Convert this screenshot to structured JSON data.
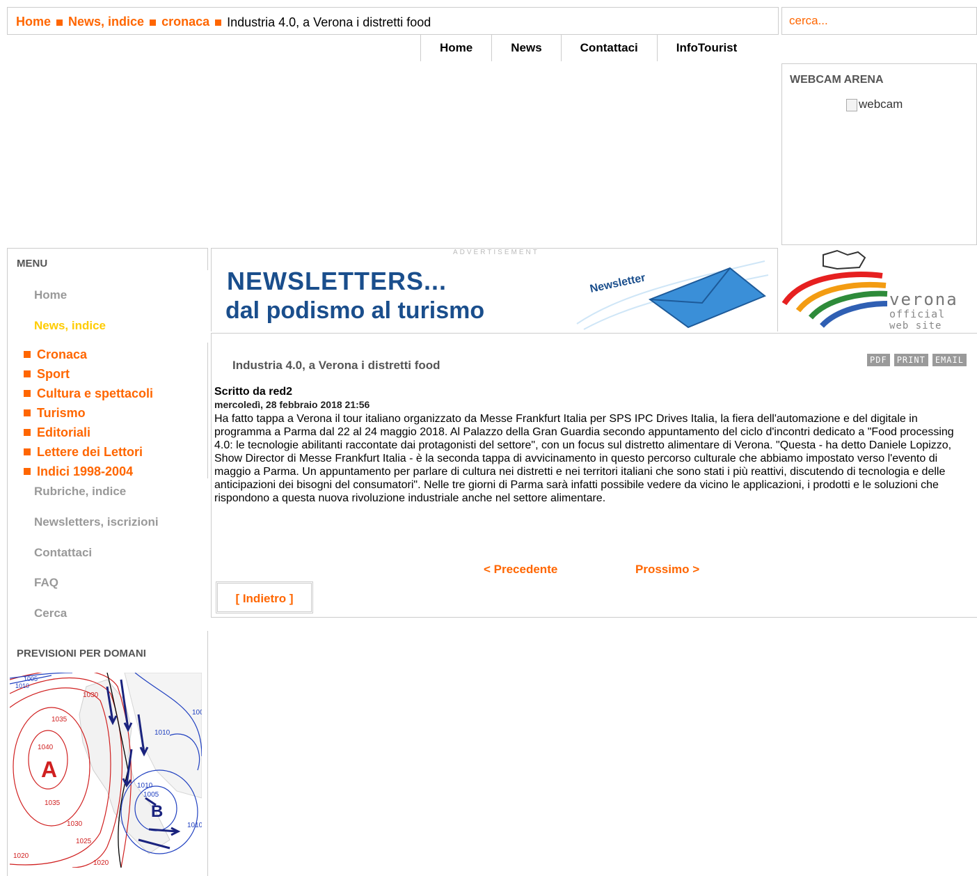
{
  "breadcrumb": {
    "items": [
      "Home",
      "News, indice",
      "cronaca"
    ],
    "current": "Industria 4.0, a Verona i distretti food"
  },
  "search": {
    "placeholder": "cerca..."
  },
  "topnav": [
    "Home",
    "News",
    "Contattaci",
    "InfoTourist"
  ],
  "webcam": {
    "title": "WEBCAM ARENA",
    "alt": "webcam"
  },
  "menu": {
    "title": "MENU",
    "home": "Home",
    "news": "News, indice",
    "sub": [
      "Cronaca",
      "Sport",
      "Cultura e spettacoli",
      "Turismo",
      "Editoriali",
      "Lettere dei Lettori",
      "Indici 1998-2004"
    ],
    "rubriche": "Rubriche, indice",
    "newsletters": "Newsletters, iscrizioni",
    "contattaci": "Contattaci",
    "faq": "FAQ",
    "cerca": "Cerca"
  },
  "forecast": {
    "title": "PREVISIONI PER DOMANI",
    "labels": [
      "1005",
      "1010",
      "1030",
      "1035",
      "1040",
      "A",
      "1035",
      "1030",
      "1025",
      "1020",
      "1020",
      "1010",
      "1005",
      "B",
      "1010",
      "1010",
      "100"
    ]
  },
  "banner": {
    "advertisement": "ADVERTISEMENT",
    "line1": "NEWSLETTERS...",
    "line2": "dal podismo al turismo",
    "envelope_text": "Newsletter"
  },
  "logo": {
    "word": "verona",
    "sub1": "official",
    "sub2": "web site"
  },
  "article": {
    "title": "Industria 4.0, a Verona i distretti food",
    "icons": [
      "PDF",
      "PRINT",
      "EMAIL"
    ],
    "author": "Scritto da red2",
    "date": "mercoledì, 28 febbraio 2018 21:56",
    "body": "Ha fatto tappa a Verona il tour italiano organizzato da Messe Frankfurt Italia per SPS IPC Drives Italia, la fiera dell'automazione e del digitale in programma a Parma dal 22 al 24 maggio 2018. Al Palazzo della Gran Guardia secondo appuntamento del ciclo d'incontri dedicato a \"Food processing 4.0: le tecnologie abilitanti raccontate dai protagonisti del settore\", con un focus sul distretto alimentare di Verona. \"Questa - ha detto Daniele Lopizzo, Show Director di Messe Frankfurt Italia - è la seconda tappa di avvicinamento in questo percorso culturale che abbiamo impostato verso l'evento di maggio a Parma. Un appuntamento per parlare di cultura nei distretti e nei territori italiani che sono stati i più reattivi, discutendo di tecnologia e delle anticipazioni dei bisogni del consumatori\". Nelle tre giorni di Parma sarà infatti possibile vedere da vicino le applicazioni, i prodotti e le soluzioni che rispondono a questa nuova rivoluzione industriale anche nel settore alimentare.",
    "prev": "< Precedente",
    "next": "Prossimo >",
    "back": "[ Indietro ]"
  },
  "colors": {
    "accent": "#ff6600",
    "border": "#cccccc",
    "muted": "#999999",
    "active": "#ffcc00"
  }
}
